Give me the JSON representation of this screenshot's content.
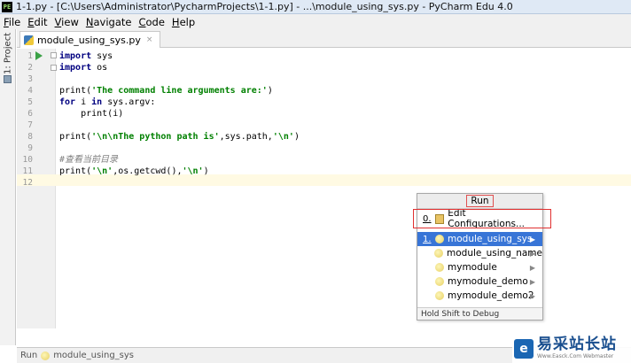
{
  "window": {
    "icon_text": "PE",
    "title": "1-1.py - [C:\\Users\\Administrator\\PycharmProjects\\1-1.py] - ...\\module_using_sys.py - PyCharm Edu 4.0"
  },
  "menu": [
    {
      "first": "F",
      "rest": "ile"
    },
    {
      "first": "E",
      "rest": "dit"
    },
    {
      "first": "V",
      "rest": "iew"
    },
    {
      "first": "N",
      "rest": "avigate"
    },
    {
      "first": "C",
      "rest": "ode"
    },
    {
      "first": "H",
      "rest": "elp"
    }
  ],
  "sidebar": {
    "project_tab": "1: Project"
  },
  "editor_tab": {
    "filename": "module_using_sys.py",
    "close": "×"
  },
  "line_numbers": [
    "1",
    "2",
    "3",
    "4",
    "5",
    "6",
    "7",
    "8",
    "9",
    "10",
    "11",
    "12"
  ],
  "code": {
    "l1_kw": "import",
    "l1_rest": " sys",
    "l2_kw": "import",
    "l2_rest": " os",
    "l4_a": "print(",
    "l4_str": "'The command line arguments are:'",
    "l4_b": ")",
    "l5_kw1": "for",
    "l5_a": " i ",
    "l5_kw2": "in",
    "l5_b": " sys.argv:",
    "l6": "    print(i)",
    "l8_a": "print(",
    "l8_str": "'\\n\\nThe python path is'",
    "l8_b": ",sys.path,",
    "l8_str2": "'\\n'",
    "l8_c": ")",
    "l10": "#查看当前目录",
    "l11_a": "print(",
    "l11_str": "'\\n'",
    "l11_b": ",os.getcwd(),",
    "l11_str2": "'\\n'",
    "l11_c": ")"
  },
  "run_popup": {
    "header": "Run",
    "edit_idx": "0.",
    "edit_label": "Edit Configurations...",
    "items": [
      {
        "idx": "1.",
        "label": "module_using_sys"
      },
      {
        "idx": "",
        "label": "module_using_name"
      },
      {
        "idx": "",
        "label": "mymodule"
      },
      {
        "idx": "",
        "label": "mymodule_demo"
      },
      {
        "idx": "",
        "label": "mymodule_demo2"
      }
    ],
    "submenu_arrow": "▶",
    "footer": "Hold Shift to Debug"
  },
  "statusbar": {
    "prefix": "Run",
    "config": "module_using_sys"
  },
  "watermark": {
    "text": "易采站长站",
    "sub": "Www.Easck.Com Webmaster"
  },
  "colors": {
    "selection": "#3875d7",
    "run_green": "#3ba146",
    "highlight_box": "#e03030"
  }
}
